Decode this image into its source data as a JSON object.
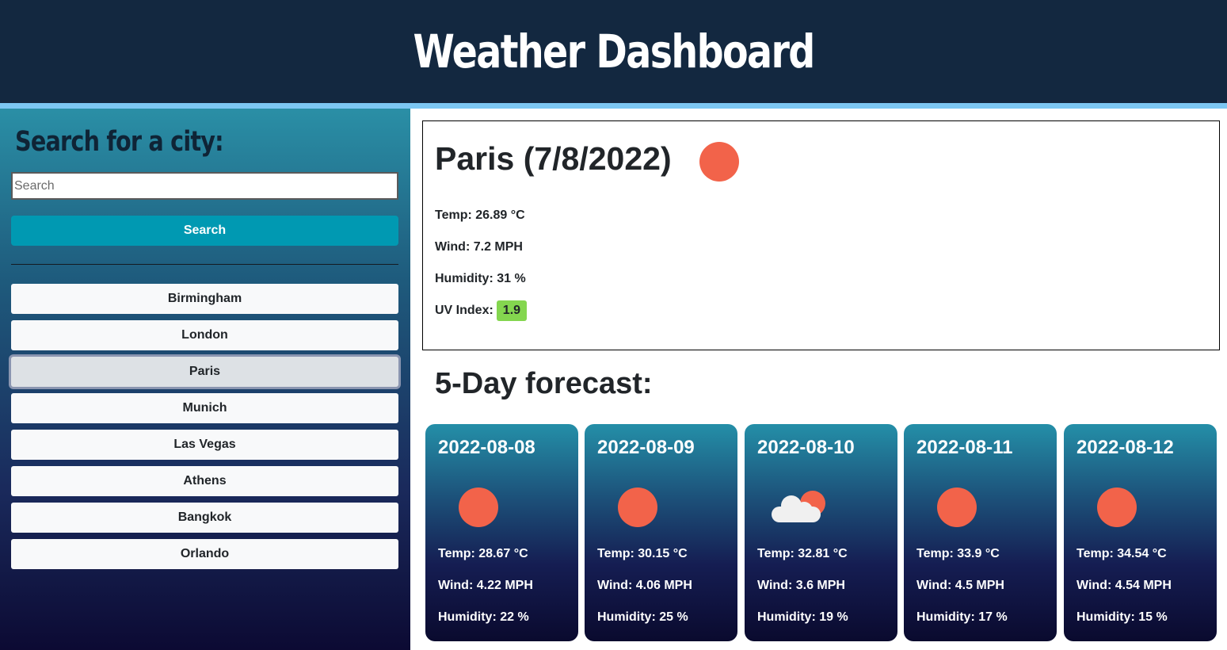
{
  "header": {
    "title": "Weather Dashboard"
  },
  "colors": {
    "header_bg": "#132840",
    "accent_stripe": "#7cc7f3",
    "search_button": "#0099b2",
    "sun": "#f2634a",
    "uv_badge": "#84d64f"
  },
  "sidebar": {
    "heading": "Search for a city:",
    "search_placeholder": "Search",
    "search_button": "Search",
    "cities": [
      "Birmingham",
      "London",
      "Paris",
      "Munich",
      "Las Vegas",
      "Athens",
      "Bangkok",
      "Orlando"
    ],
    "active_city": "Paris"
  },
  "current": {
    "title": "Paris (7/8/2022)",
    "icon": "sun-icon",
    "temp": "Temp: 26.89 °C",
    "wind": "Wind: 7.2 MPH",
    "humidity": "Humidity: 31 %",
    "uv_label": "UV Index:",
    "uv_value": "1.9"
  },
  "forecast": {
    "title": "5-Day forecast:",
    "days": [
      {
        "date": "2022-08-08",
        "icon": "sun-icon",
        "temp": "Temp: 28.67 °C",
        "wind": "Wind: 4.22 MPH",
        "humidity": "Humidity: 22 %"
      },
      {
        "date": "2022-08-09",
        "icon": "sun-icon",
        "temp": "Temp: 30.15 °C",
        "wind": "Wind: 4.06 MPH",
        "humidity": "Humidity: 25 %"
      },
      {
        "date": "2022-08-10",
        "icon": "partly-cloudy-icon",
        "temp": "Temp: 32.81 °C",
        "wind": "Wind: 3.6 MPH",
        "humidity": "Humidity: 19 %"
      },
      {
        "date": "2022-08-11",
        "icon": "sun-icon",
        "temp": "Temp: 33.9 °C",
        "wind": "Wind: 4.5 MPH",
        "humidity": "Humidity: 17 %"
      },
      {
        "date": "2022-08-12",
        "icon": "sun-icon",
        "temp": "Temp: 34.54 °C",
        "wind": "Wind: 4.54 MPH",
        "humidity": "Humidity: 15 %"
      }
    ]
  }
}
